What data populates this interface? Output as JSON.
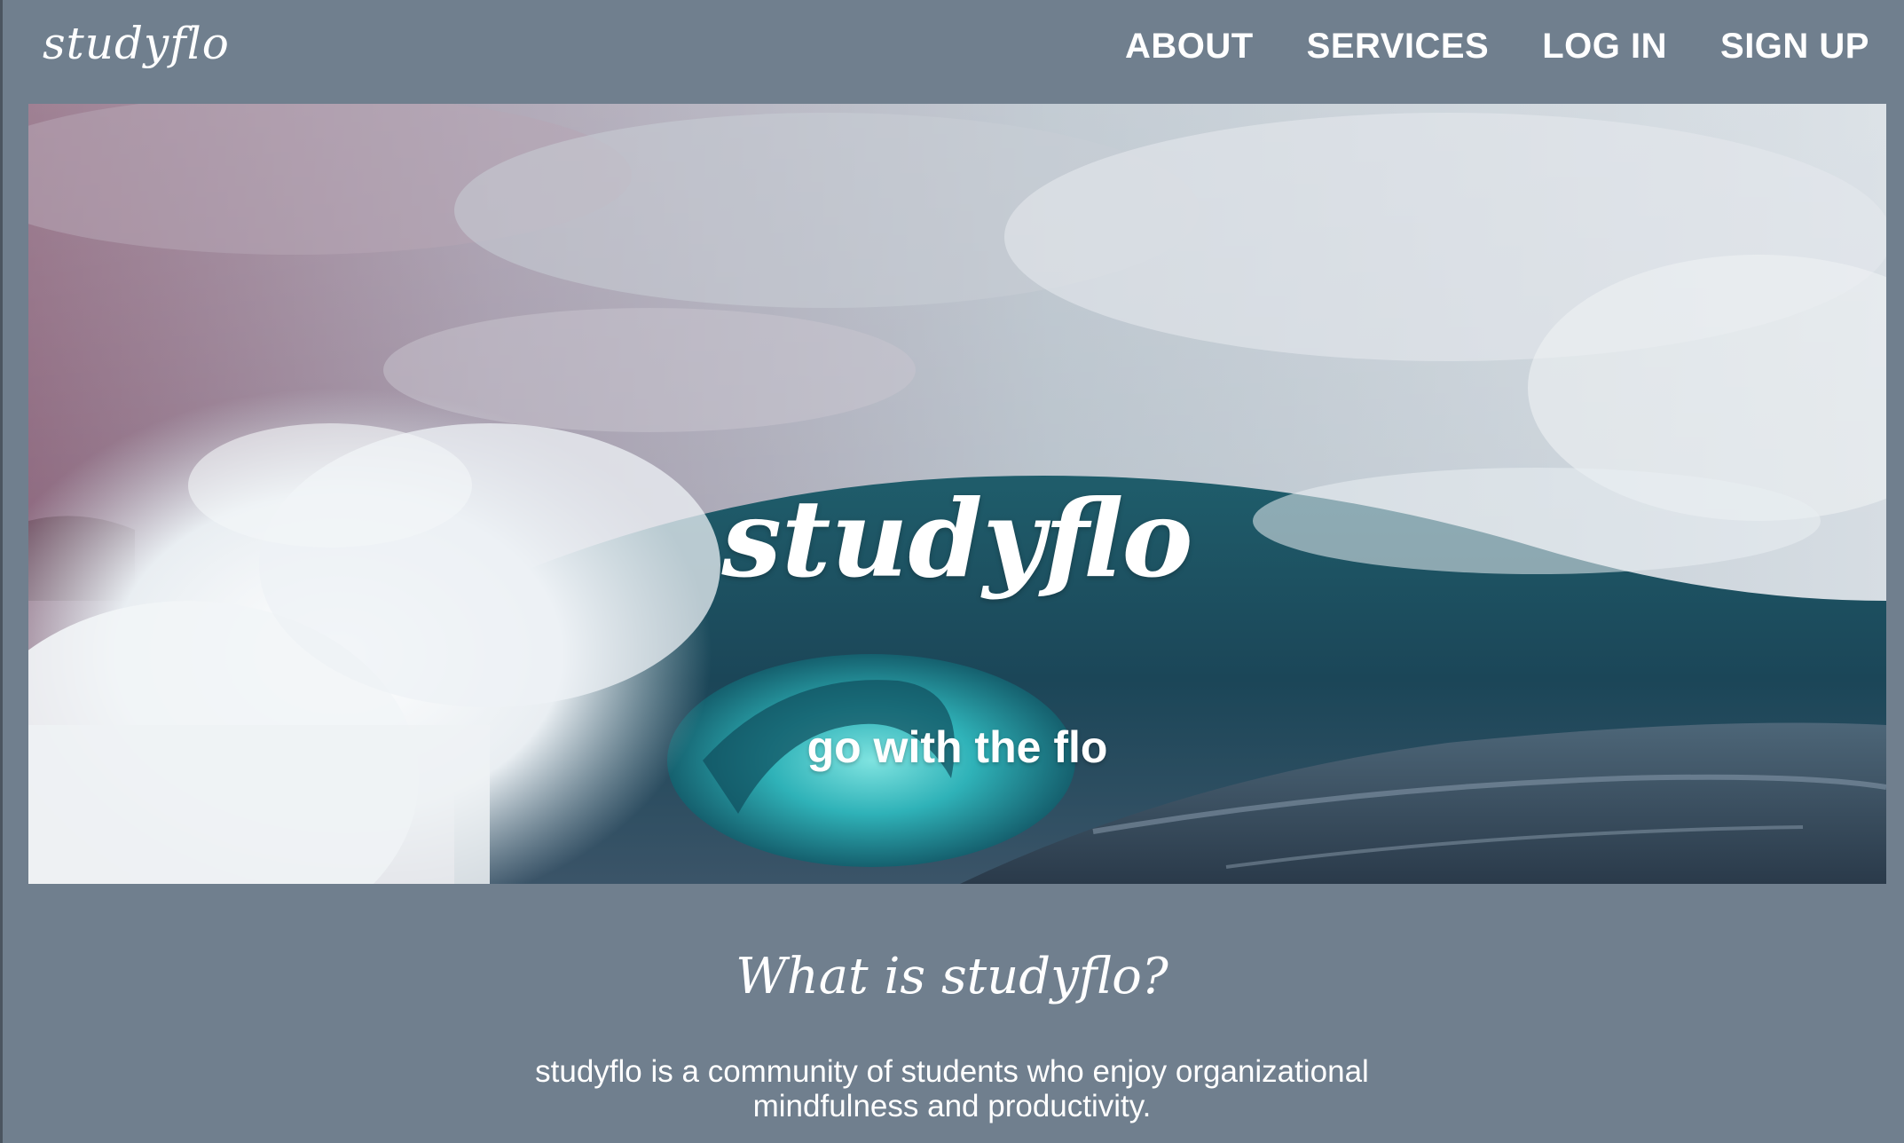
{
  "header": {
    "logo": "studyflo",
    "nav": [
      {
        "label": "ABOUT"
      },
      {
        "label": "SERVICES"
      },
      {
        "label": "LOG IN"
      },
      {
        "label": "SIGN UP"
      }
    ]
  },
  "hero": {
    "title": "studyflo",
    "tagline": "go with the flo",
    "image_subject": "ocean-wave"
  },
  "about": {
    "heading": "What is studyflo?",
    "text": "studyflo is a community of students who enjoy organizational mindfulness and productivity."
  },
  "colors": {
    "background": "#707f8e",
    "text": "#ffffff",
    "wave_teal": "#1d6a78",
    "sky_pink": "#9a6f86"
  }
}
